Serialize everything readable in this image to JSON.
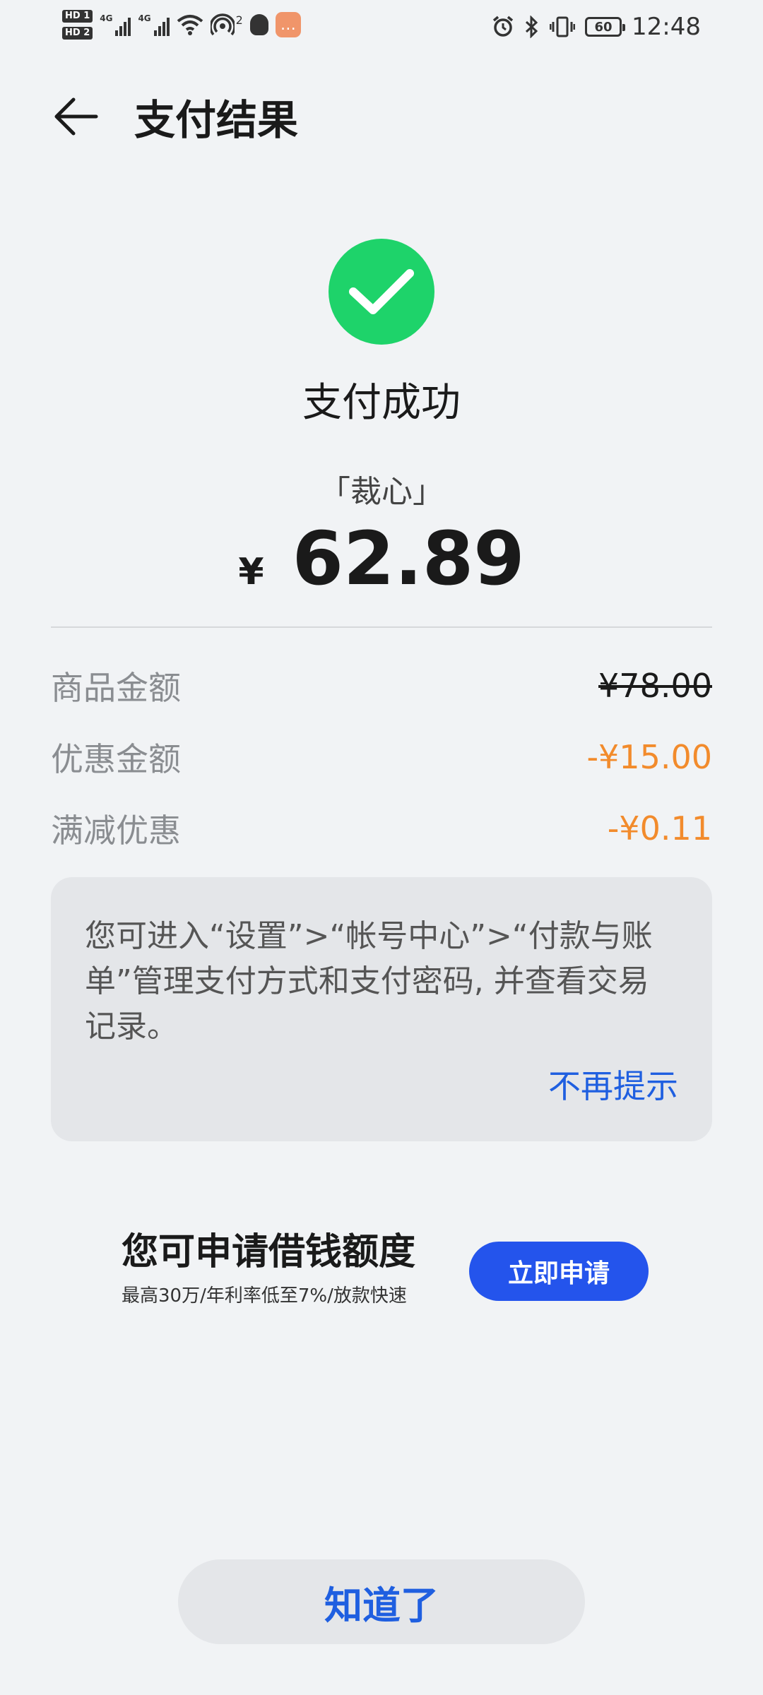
{
  "status_bar": {
    "hd1": "HD 1",
    "hd2": "HD 2",
    "net1": "4G",
    "net2": "4G",
    "hotspot_count": "2",
    "battery": "60",
    "time": "12:48"
  },
  "header": {
    "title": "支付结果"
  },
  "result": {
    "status": "支付成功",
    "merchant": "「裁心」",
    "currency": "¥",
    "amount": "62.89"
  },
  "details": [
    {
      "label": "商品金额",
      "value": "¥78.00",
      "style": "strike"
    },
    {
      "label": "优惠金额",
      "value": "-¥15.00",
      "style": "orange"
    },
    {
      "label": "满减优惠",
      "value": "-¥0.11",
      "style": "orange"
    }
  ],
  "tip": {
    "text": "您可进入“设置”>“帐号中心”>“付款与账单”管理支付方式和支付密码, 并查看交易记录。",
    "dismiss_label": "不再提示"
  },
  "promo": {
    "title": "您可申请借钱额度",
    "subtitle": "最高30万/年利率低至7%/放款快速",
    "button_label": "立即申请"
  },
  "footer": {
    "ok_label": "知道了"
  },
  "colors": {
    "success_green": "#1ed36a",
    "accent_blue": "#1f5fe0",
    "discount_orange": "#f28b2c",
    "button_blue": "#2454ec"
  },
  "icons": {
    "back": "arrow-left-icon",
    "success": "check-circle-icon"
  }
}
